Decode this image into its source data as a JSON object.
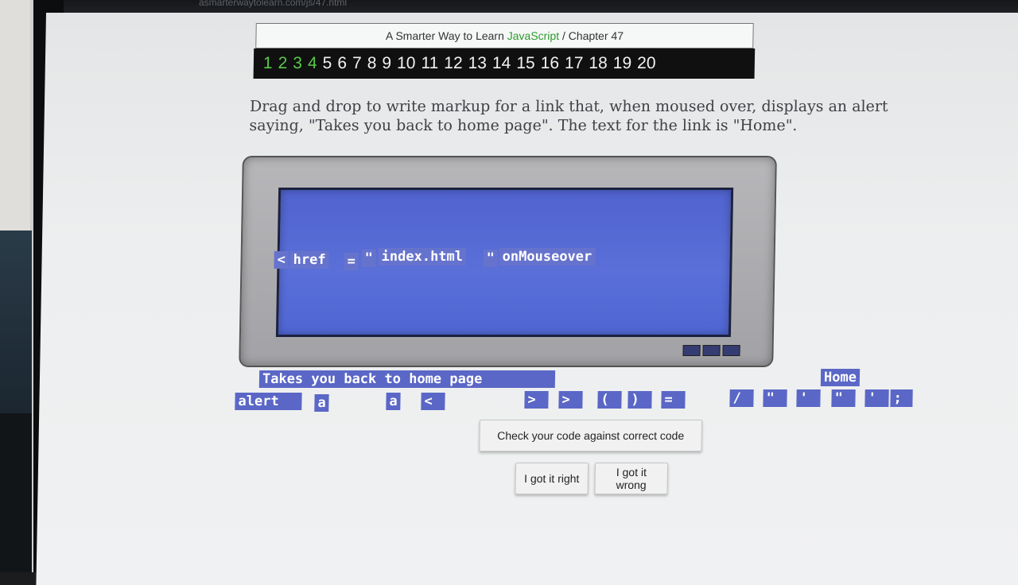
{
  "browser": {
    "url": "asmarterwaytolearn.com/js/47.html"
  },
  "header": {
    "title_prefix": "A Smarter Way to Learn ",
    "title_highlight": "JavaScript",
    "title_suffix": " / Chapter 47",
    "chapters": [
      "1",
      "2",
      "3",
      "4",
      "5",
      "6",
      "7",
      "8",
      "9",
      "10",
      "11",
      "12",
      "13",
      "14",
      "15",
      "16",
      "17",
      "18",
      "19",
      "20"
    ]
  },
  "instructions": "Drag and drop to write markup for a link that, when moused over, displays an alert saying, \"Takes you back to home page\". The text for the link is \"Home\".",
  "placed_tokens": [
    {
      "label": "<"
    },
    {
      "label": "href"
    },
    {
      "label": "="
    },
    {
      "label": "\""
    },
    {
      "label": "index.html"
    },
    {
      "label": "\""
    },
    {
      "label": "onMouseover"
    }
  ],
  "tokens": [
    {
      "label": "Takes you back to home page"
    },
    {
      "label": "alert"
    },
    {
      "label": "a"
    },
    {
      "label": "a"
    },
    {
      "label": "<"
    },
    {
      "label": ">"
    },
    {
      "label": ">"
    },
    {
      "label": "("
    },
    {
      "label": ")"
    },
    {
      "label": "="
    },
    {
      "label": "/"
    },
    {
      "label": "\""
    },
    {
      "label": "'"
    },
    {
      "label": "\""
    },
    {
      "label": "'"
    },
    {
      "label": ";"
    },
    {
      "label": "Home"
    }
  ],
  "buttons": {
    "check": "Check your code against correct code",
    "got_right": "I got it right",
    "got_wrong": "I got it wrong"
  },
  "colors": {
    "token_bg": "#5a67c6",
    "chapter_done": "#59c84a",
    "brand_js": "#2d9b2d"
  }
}
